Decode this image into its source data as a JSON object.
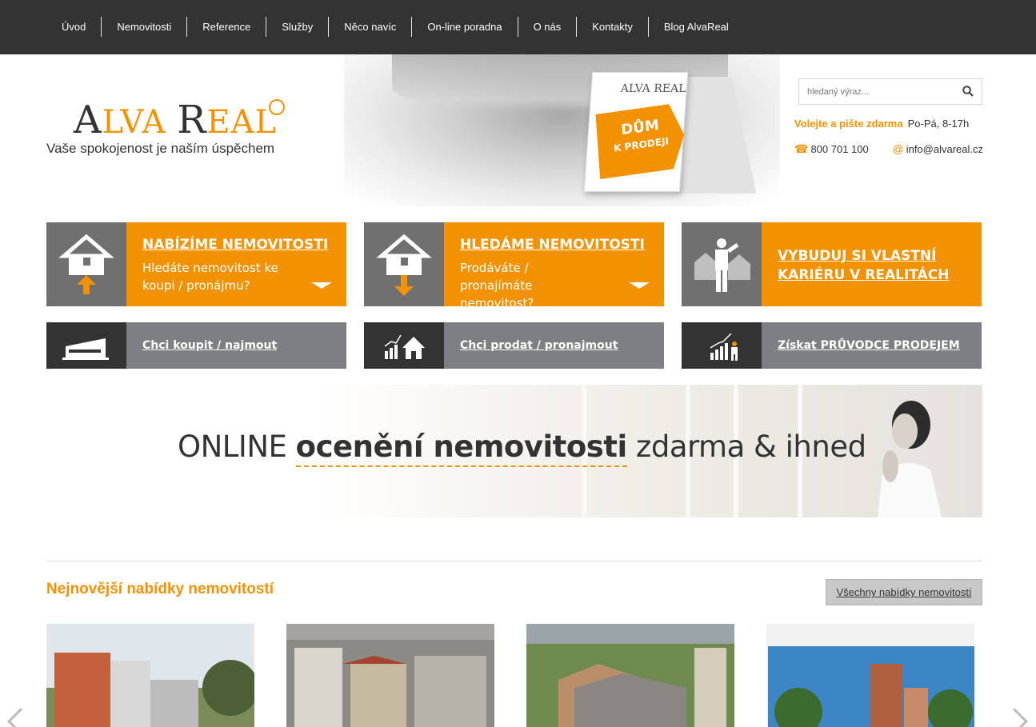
{
  "nav": {
    "items": [
      "Úvod",
      "Nemovitosti",
      "Reference",
      "Služby",
      "Něco navíc",
      "On-line poradna",
      "O nás",
      "Kontakty",
      "Blog AlvaReal"
    ]
  },
  "header": {
    "logo_a": "A",
    "logo_lva": "LVA ",
    "logo_r": "R",
    "logo_eal": "EAL",
    "tagline": "Vaše spokojenost je naším úspěchem",
    "sign_logo": "ALVA REAL",
    "sign_line1": "DŮM",
    "sign_line2": "K PRODEJI",
    "search_placeholder": "hledaný výraz...",
    "call_label": "Volejte a pište zdarma",
    "call_hours": "Po-Pá, 8-17h",
    "phone": "800 701 100",
    "email": "info@alvareal.cz"
  },
  "tiles": [
    {
      "title": "NABÍZÍME NEMOVITOSTI",
      "desc": "Hledáte nemovitost ke koupi / pronájmu?",
      "icon": "house-up-arrow-icon"
    },
    {
      "title": "HLEDÁME NEMOVITOSTI",
      "desc": "Prodáváte / pronajímáte nemovitost?",
      "icon": "house-down-arrow-icon"
    },
    {
      "title": "VYBUDUJ SI VLASTNÍ KARIÉRU V REALITÁCH",
      "desc": "",
      "icon": "agent-houses-icon"
    }
  ],
  "small_tiles": [
    {
      "label": "Chci koupit / najmout",
      "icon": "building-icon"
    },
    {
      "label": "Chci prodat / pronajmout",
      "icon": "growth-house-icon"
    },
    {
      "label": "Získat PRŮVODCE PRODEJEM",
      "icon": "growth-person-icon"
    }
  ],
  "banner": {
    "pre": "ONLINE ",
    "bold": "ocenění nemovitosti",
    "post": " zdarma & ihned"
  },
  "listings": {
    "title": "Nejnovější nabídky nemovitostí",
    "all_button": "Všechny nabídky nemovitostí"
  },
  "colors": {
    "accent": "#f39200",
    "nav_bg": "#333333",
    "tile_gray": "#707070",
    "small_tile_gray": "#7d7f83"
  }
}
